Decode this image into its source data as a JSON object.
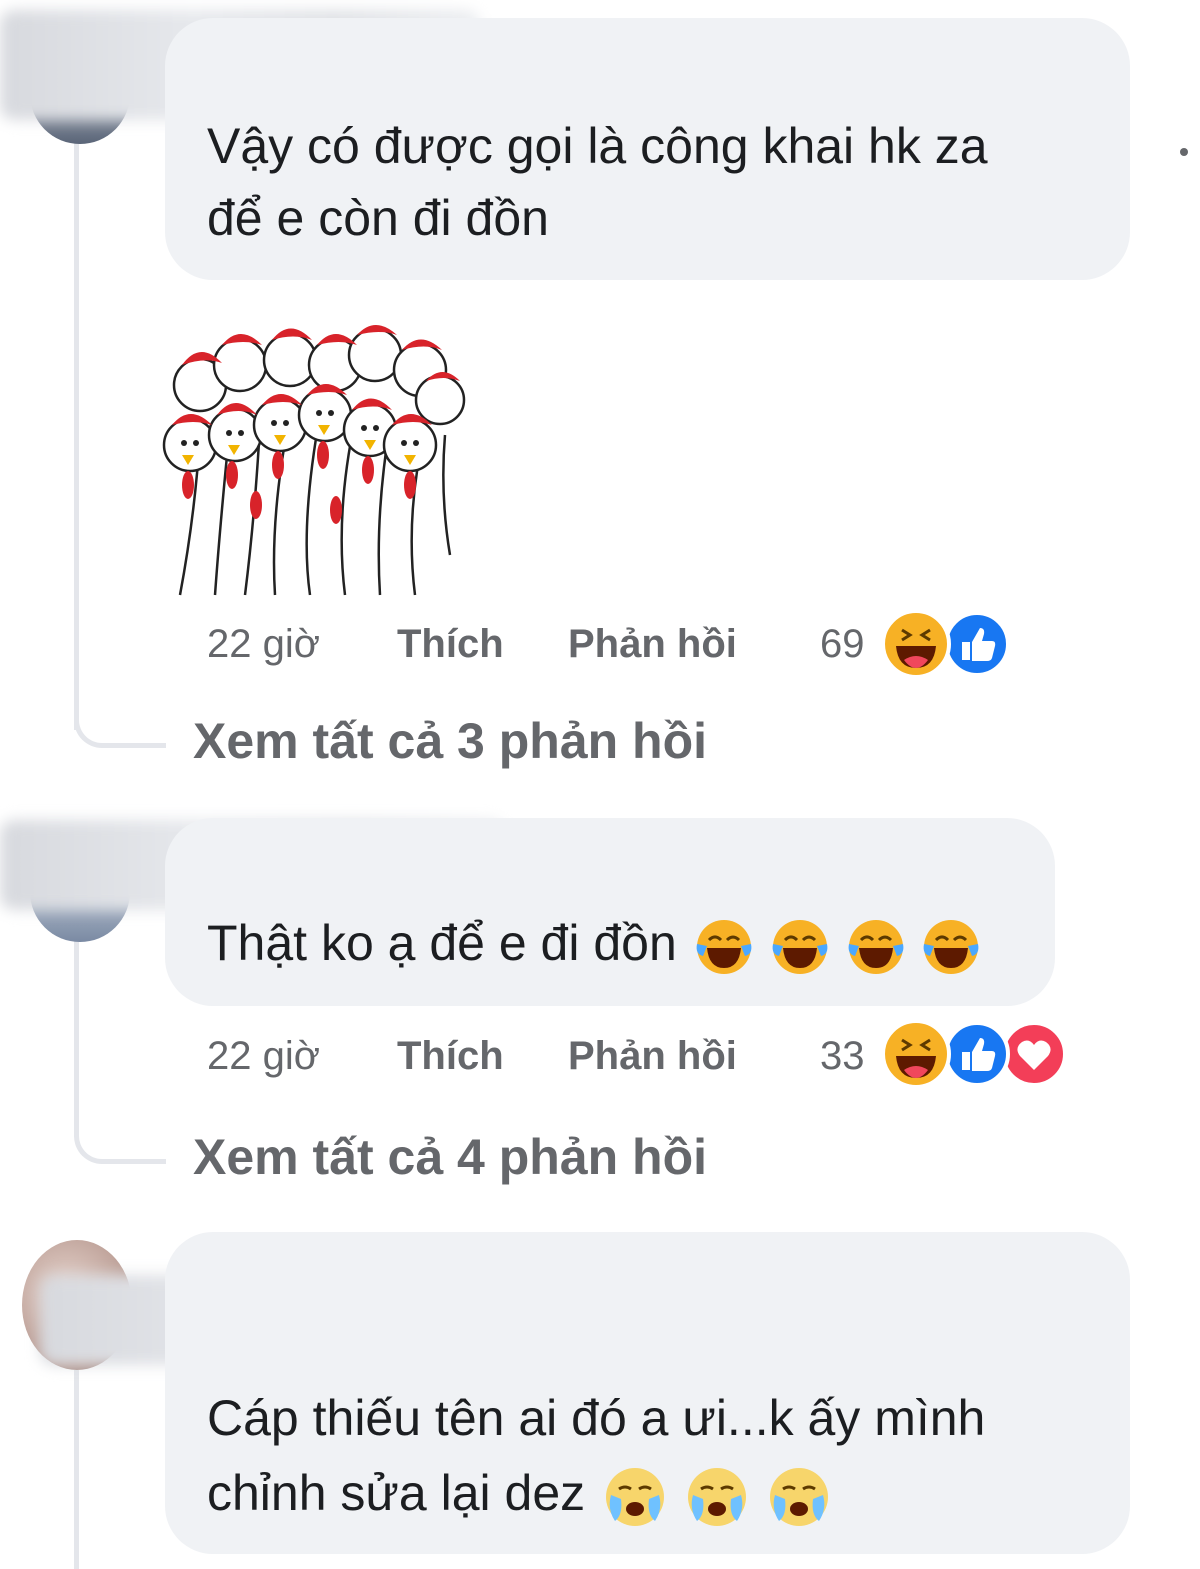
{
  "comments": [
    {
      "text_lines": [
        "Vậy có được gọi là công khai hk za",
        "để e còn đi đồn"
      ],
      "time": "22 giờ",
      "like_label": "Thích",
      "reply_label": "Phản hồi",
      "reaction_count": "69",
      "reactions": [
        "haha",
        "like"
      ],
      "view_replies": "Xem tất cả 3 phản hồi",
      "sticker": "chicken-flock-sticker"
    },
    {
      "text": "Thật ko ạ để e đi đồn",
      "inline_emojis": [
        "laughing-tears-emoji",
        "laughing-tears-emoji",
        "laughing-tears-emoji",
        "laughing-tears-emoji"
      ],
      "time": "22 giờ",
      "like_label": "Thích",
      "reply_label": "Phản hồi",
      "reaction_count": "33",
      "reactions": [
        "haha",
        "like",
        "love"
      ],
      "view_replies": "Xem tất cả 4 phản hồi"
    },
    {
      "text_lines": [
        "Cáp thiếu tên ai đó a ưi...k ấy mình",
        "chỉnh sửa lại dez"
      ],
      "inline_emojis": [
        "crying-emoji",
        "crying-emoji",
        "crying-emoji"
      ]
    }
  ],
  "colors": {
    "bubble": "#f0f2f5",
    "meta_text": "#65676b",
    "like_blue": "#1877f2",
    "love_red": "#f33e58",
    "haha_yellow": "#f7b125"
  }
}
